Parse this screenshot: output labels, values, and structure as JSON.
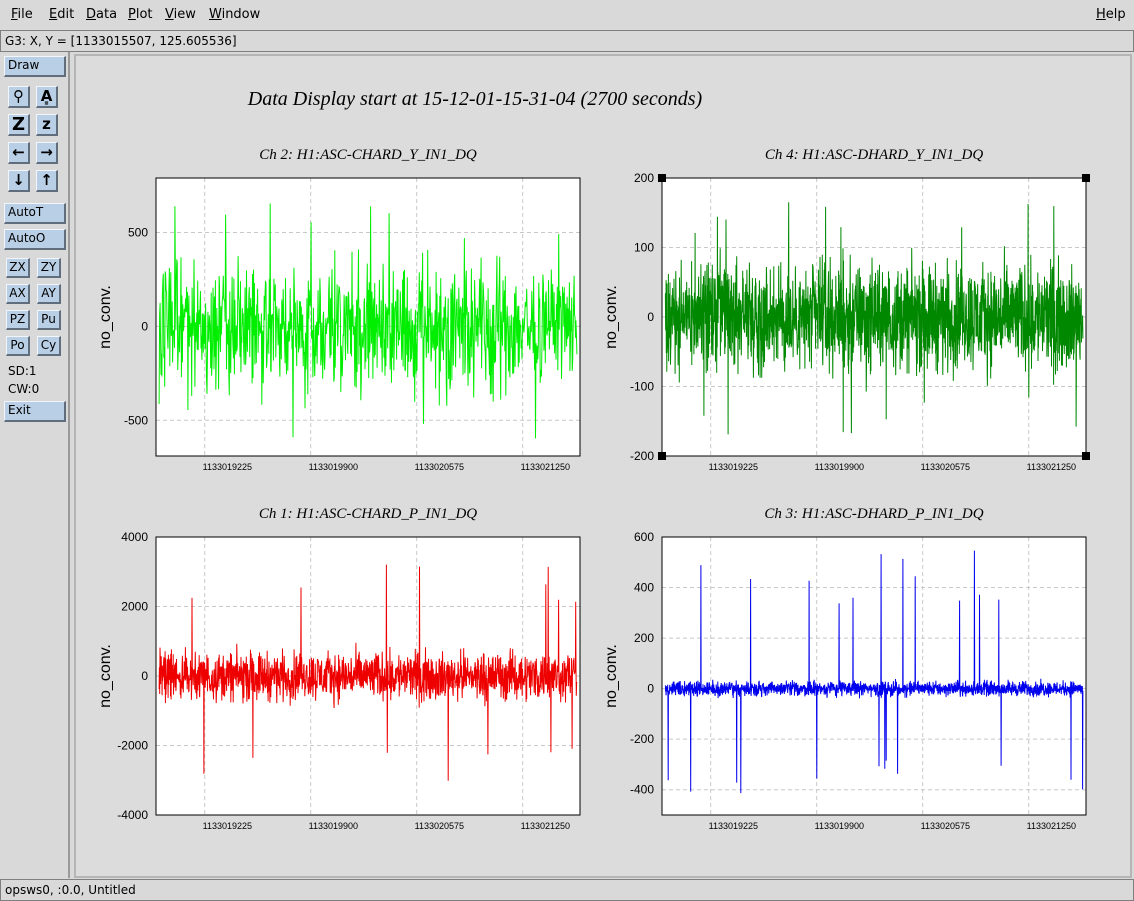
{
  "menu": {
    "items": [
      "File",
      "Edit",
      "Data",
      "Plot",
      "View",
      "Window"
    ],
    "help": "Help"
  },
  "coord_readout": "G3: X, Y = [1133015507, 125.605536]",
  "toolbar": {
    "draw": "Draw",
    "icons": [
      {
        "name": "pointer-icon",
        "glyph": "⚲"
      },
      {
        "name": "text-icon",
        "glyph": "A͇"
      },
      {
        "name": "zoom-in-z-icon",
        "glyph": "Z"
      },
      {
        "name": "zoom-out-z-icon",
        "glyph": "z"
      },
      {
        "name": "arrow-left-icon",
        "glyph": "←"
      },
      {
        "name": "arrow-right-icon",
        "glyph": "→"
      },
      {
        "name": "arrow-down-icon",
        "glyph": "↓"
      },
      {
        "name": "arrow-up-icon",
        "glyph": "↑"
      }
    ],
    "autot": "AutoT",
    "autoo": "AutoO",
    "small_buttons": [
      "ZX",
      "ZY",
      "AX",
      "AY",
      "PZ",
      "Pu",
      "Po",
      "Cy"
    ],
    "sd": "SD:1",
    "cw": "CW:0",
    "exit": "Exit"
  },
  "status": "opsws0, :0.0, Untitled",
  "chart_data": {
    "main_title": "Data Display start at 15-12-01-15-31-04 (2700 seconds)",
    "charts": [
      {
        "type": "line",
        "title": "Ch 2: H1:ASC-CHARD_Y_IN1_DQ",
        "ylabel": "no_conv.",
        "color": "#00ee00",
        "xlim": [
          1133018915,
          1133021615
        ],
        "ylim": [
          -690,
          790
        ],
        "xticks": [
          1133019225,
          1133019900,
          1133020575,
          1133021250
        ],
        "yticks": [
          -500,
          0,
          500
        ],
        "noise": {
          "amplitude": 200,
          "spike_max": 720,
          "spike_min": -640,
          "samples": 900
        },
        "selected": false
      },
      {
        "type": "line",
        "title": "Ch 4: H1:ASC-DHARD_Y_IN1_DQ",
        "ylabel": "no_conv.",
        "color": "#008800",
        "xlim": [
          1133018915,
          1133021615
        ],
        "ylim": [
          -200,
          200
        ],
        "xticks": [
          1133019225,
          1133019900,
          1133020575,
          1133021250
        ],
        "yticks": [
          -200,
          -100,
          0,
          100,
          200
        ],
        "noise": {
          "amplitude": 45,
          "spike_max": 180,
          "spike_min": -170,
          "samples": 1800
        },
        "selected": true
      },
      {
        "type": "line",
        "title": "Ch 1: H1:ASC-CHARD_P_IN1_DQ",
        "ylabel": "no_conv.",
        "color": "#ee0000",
        "xlim": [
          1133018915,
          1133021615
        ],
        "ylim": [
          -4000,
          4000
        ],
        "xticks": [
          1133019225,
          1133019900,
          1133020575,
          1133021250
        ],
        "yticks": [
          -4000,
          -2000,
          0,
          2000,
          4000
        ],
        "noise": {
          "amplitude": 420,
          "spike_max": 3550,
          "spike_min": -3250,
          "samples": 1400
        },
        "selected": false
      },
      {
        "type": "line",
        "title": "Ch 3: H1:ASC-DHARD_P_IN1_DQ",
        "ylabel": "no_conv.",
        "color": "#0000ee",
        "xlim": [
          1133018915,
          1133021615
        ],
        "ylim": [
          -500,
          600
        ],
        "xticks": [
          1133019225,
          1133019900,
          1133020575,
          1133021250
        ],
        "yticks": [
          -400,
          -200,
          0,
          200,
          400,
          600
        ],
        "noise": {
          "amplitude": 18,
          "spike_max": 550,
          "spike_min": -450,
          "samples": 1800
        },
        "selected": false
      }
    ]
  }
}
